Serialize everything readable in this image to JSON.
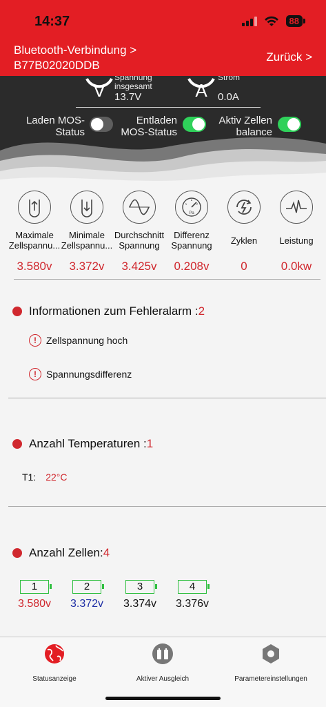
{
  "status_bar": {
    "time": "14:37",
    "battery": "88"
  },
  "header": {
    "connection_label": "Bluetooth-Verbindung >",
    "device_id": "B77B02020DDB",
    "back_label": "Zurück >"
  },
  "overview": {
    "voltage": {
      "label_line1": "Spannung",
      "label_line2": "insgesamt",
      "value": "13.7V",
      "symbol": "V"
    },
    "current": {
      "label": "Strom",
      "value": "0.0A",
      "symbol": "A"
    },
    "toggles": [
      {
        "label_line1": "Laden MOS-",
        "label_line2": "Status",
        "state": "off"
      },
      {
        "label_line1": "Entladen",
        "label_line2": "MOS-Status",
        "state": "on"
      },
      {
        "label_line1": "Aktiv Zellen",
        "label_line2": "balance",
        "state": "on"
      }
    ]
  },
  "metrics": [
    {
      "label_line1": "Maximale",
      "label_line2": "Zellspannu...",
      "value": "3.580v",
      "icon": "arrow-up-icon"
    },
    {
      "label_line1": "Minimale",
      "label_line2": "Zellspannu...",
      "value": "3.372v",
      "icon": "arrow-down-icon"
    },
    {
      "label_line1": "Durchschnitt",
      "label_line2": "Spannung",
      "value": "3.425v",
      "icon": "sine-wave-icon"
    },
    {
      "label_line1": "Differenz",
      "label_line2": "Spannung",
      "value": "0.208v",
      "icon": "gauge-icon"
    },
    {
      "label_line1": "Zyklen",
      "label_line2": "",
      "value": "0",
      "icon": "cycle-icon"
    },
    {
      "label_line1": "Leistung",
      "label_line2": "",
      "value": "0.0kw",
      "icon": "pulse-icon"
    }
  ],
  "alarms": {
    "title": "Informationen zum Fehleralarm :",
    "count": "2",
    "items": [
      "Zellspannung hoch",
      "Spannungsdifferenz"
    ]
  },
  "temperatures": {
    "title": "Anzahl Temperaturen :",
    "count": "1",
    "items": [
      {
        "label": "T1:",
        "value": "22°C"
      }
    ]
  },
  "cells": {
    "title": "Anzahl Zellen:",
    "count": "4",
    "items": [
      {
        "index": "1",
        "voltage": "3.580v",
        "color": "#d0282e"
      },
      {
        "index": "2",
        "voltage": "3.372v",
        "color": "#1f2fa6"
      },
      {
        "index": "3",
        "voltage": "3.374v",
        "color": "#111111"
      },
      {
        "index": "4",
        "voltage": "3.376v",
        "color": "#111111"
      }
    ]
  },
  "tabs": [
    {
      "label": "Statusanzeige",
      "icon": "globe-icon",
      "active": true
    },
    {
      "label": "Aktiver Ausgleich",
      "icon": "battery-balance-icon",
      "active": false
    },
    {
      "label": "Parametereinstellungen",
      "icon": "hexagon-settings-icon",
      "active": false
    }
  ],
  "colors": {
    "brand_red": "#e31e24",
    "value_red": "#d0282e",
    "toggle_green": "#2fd15a",
    "cell_border": "#2fbf3f"
  }
}
